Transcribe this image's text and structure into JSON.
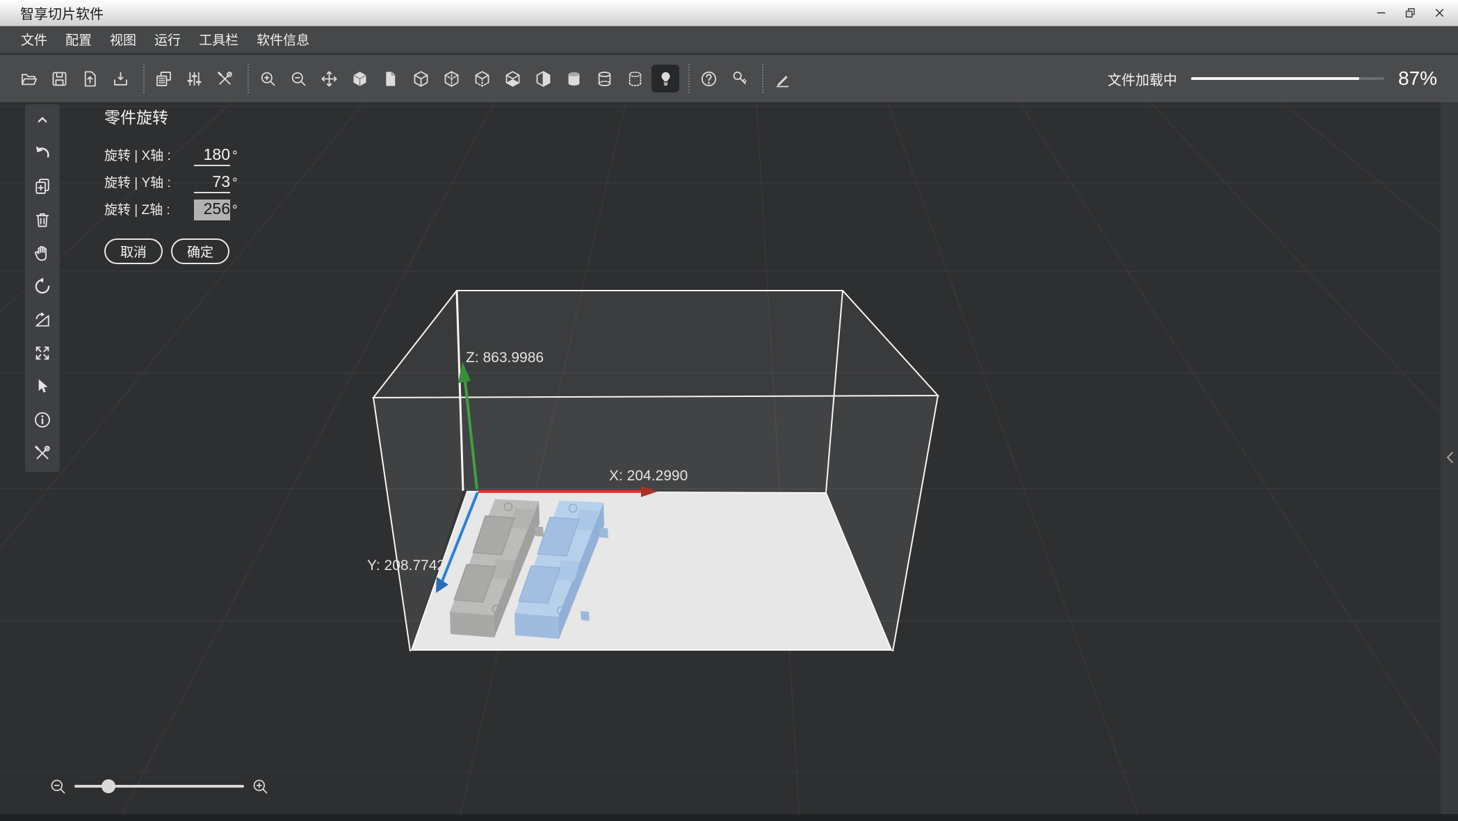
{
  "window": {
    "title": "智享切片软件",
    "controls": [
      {
        "name": "minimize"
      },
      {
        "name": "restore"
      },
      {
        "name": "close"
      }
    ]
  },
  "menu": {
    "items": [
      {
        "label": "文件"
      },
      {
        "label": "配置"
      },
      {
        "label": "视图"
      },
      {
        "label": "运行"
      },
      {
        "label": "工具栏"
      },
      {
        "label": "软件信息"
      }
    ]
  },
  "toolbar": {
    "items": [
      {
        "icon": "open-file"
      },
      {
        "icon": "save-file"
      },
      {
        "icon": "import-model"
      },
      {
        "icon": "export-model"
      },
      {
        "sep": true
      },
      {
        "icon": "build-plates"
      },
      {
        "icon": "parameter-sliders"
      },
      {
        "icon": "tools"
      },
      {
        "sep": true
      },
      {
        "icon": "zoom-in"
      },
      {
        "icon": "zoom-out"
      },
      {
        "icon": "move"
      },
      {
        "icon": "cube-solid"
      },
      {
        "icon": "sheet"
      },
      {
        "icon": "cube-wireframe"
      },
      {
        "icon": "cube-hidden-edges"
      },
      {
        "icon": "cube-dashed-bottom"
      },
      {
        "icon": "cube-bottom-face"
      },
      {
        "icon": "cube-diagonal-split"
      },
      {
        "icon": "cylinder-solid"
      },
      {
        "icon": "cylinder-wireframe"
      },
      {
        "icon": "cylinder-dotted"
      },
      {
        "icon": "light-bulb",
        "active": true
      },
      {
        "sep": true
      },
      {
        "icon": "help"
      },
      {
        "icon": "probe-key"
      },
      {
        "sep": true
      },
      {
        "icon": "pen"
      }
    ]
  },
  "loading": {
    "label": "文件加载中",
    "percent": 87,
    "percent_label": "87%"
  },
  "left_toolbar": {
    "items": [
      {
        "icon": "collapse-up"
      },
      {
        "icon": "undo"
      },
      {
        "icon": "duplicate"
      },
      {
        "icon": "delete"
      },
      {
        "icon": "pan-hand"
      },
      {
        "icon": "rotate-ccw"
      },
      {
        "icon": "flip-mirror"
      },
      {
        "icon": "fit-view"
      },
      {
        "icon": "select-cursor"
      },
      {
        "icon": "info"
      },
      {
        "icon": "repair-tools"
      }
    ]
  },
  "rotation_panel": {
    "title": "零件旋转",
    "rows": [
      {
        "label": "旋转 | X轴 :",
        "value": "180",
        "unit": "°",
        "selected": false
      },
      {
        "label": "旋转 | Y轴 :",
        "value": "73",
        "unit": "°",
        "selected": false
      },
      {
        "label": "旋转 | Z轴 :",
        "value": "256",
        "unit": "°",
        "selected": true
      }
    ],
    "cancel_label": "取消",
    "confirm_label": "确定"
  },
  "viewport": {
    "axes": {
      "x_label": "X: 204.2990",
      "y_label": "Y: 208.7742",
      "z_label": "Z: 863.9986",
      "x_color": "#d8372a",
      "y_color": "#2b7fd8",
      "z_color": "#3fa03f"
    },
    "plate_color": "#e6e6e6",
    "parts": [
      {
        "name": "part-gray",
        "color": "#bcbcba"
      },
      {
        "name": "part-blue",
        "color": "#b7d1ec",
        "selected": true
      }
    ]
  },
  "zoom_control": {
    "level_fraction": 0.2
  }
}
